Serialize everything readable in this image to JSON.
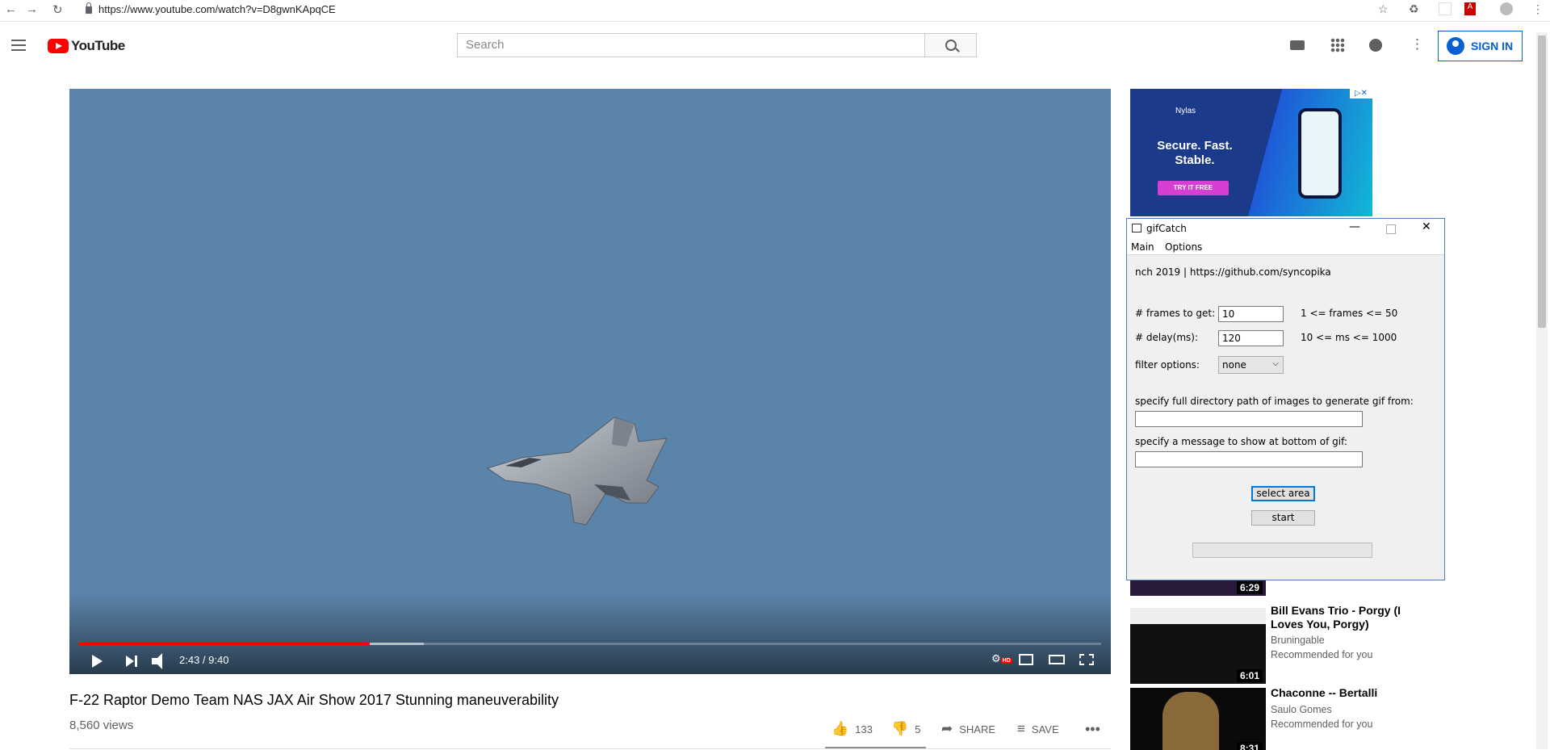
{
  "browser": {
    "url": "https://www.youtube.com/watch?v=D8gwnKApqCE",
    "back_icon": "back-arrow-icon",
    "forward_icon": "forward-arrow-icon",
    "reload_icon": "reload-icon"
  },
  "masthead": {
    "logo_text": "YouTube",
    "search_placeholder": "Search",
    "signin_label": "SIGN IN",
    "accent": "#065fd4",
    "brand_red": "#ff0000"
  },
  "player": {
    "time": "2:43 / 9:40",
    "progress_played": 0.284,
    "progress_buffered": 0.337,
    "quality_badge": "HD"
  },
  "video": {
    "title": "F-22 Raptor Demo Team NAS JAX Air Show 2017 Stunning maneuverability",
    "views": "8,560 views",
    "likes": "133",
    "dislikes": "5",
    "share_label": "SHARE",
    "save_label": "SAVE"
  },
  "ad": {
    "brand": "Nylas",
    "headline": "Secure. Fast. Stable.",
    "cta": "TRY IT FREE"
  },
  "related": [
    {
      "duration": "6:29"
    },
    {
      "title": "Bill Evans Trio - Porgy (I Loves You, Porgy)",
      "channel": "Bruningable",
      "meta": "Recommended for you",
      "duration": "6:01"
    },
    {
      "title": "Chaconne -- Bertalli",
      "channel": "Saulo Gomes",
      "meta": "Recommended for you",
      "duration": "8:31"
    }
  ],
  "gifcatch": {
    "title": "gifCatch",
    "menu": [
      "Main",
      "Options"
    ],
    "credit": "nch 2019  |  https://github.com/syncopika",
    "frames_label": "# frames to get:",
    "frames_value": "10",
    "frames_hint": "1 <= frames <= 50",
    "delay_label": "# delay(ms):",
    "delay_value": "120",
    "delay_hint": "10 <= ms <= 1000",
    "filter_label": "filter options:",
    "filter_value": "none",
    "dir_label": "specify full directory path of images to generate gif from:",
    "dir_value": "",
    "msg_label": "specify a message to show at bottom of gif:",
    "msg_value": "",
    "select_area_label": "select area",
    "start_label": "start"
  }
}
